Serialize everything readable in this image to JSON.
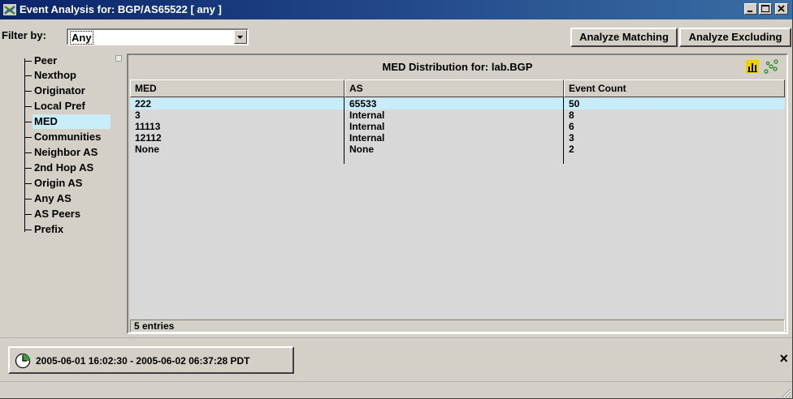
{
  "window": {
    "title": "Event Analysis for: BGP/AS65522 [  any ]"
  },
  "filter": {
    "label": "Filter by:",
    "selected": "Any",
    "analyze_matching": "Analyze Matching",
    "analyze_excluding": "Analyze Excluding"
  },
  "tree": {
    "items": [
      {
        "label": "Peer"
      },
      {
        "label": "Nexthop"
      },
      {
        "label": "Originator"
      },
      {
        "label": "Local Pref"
      },
      {
        "label": "MED"
      },
      {
        "label": "Communities"
      },
      {
        "label": "Neighbor AS"
      },
      {
        "label": "2nd Hop AS"
      },
      {
        "label": "Origin AS"
      },
      {
        "label": "Any AS"
      },
      {
        "label": "AS Peers"
      },
      {
        "label": "Prefix"
      }
    ],
    "selected": "MED"
  },
  "panel": {
    "title": "MED Distribution for: lab.BGP",
    "icons": [
      "bar-chart-icon",
      "scatter-plot-icon"
    ]
  },
  "table": {
    "columns": [
      "MED",
      "AS",
      "Event Count"
    ],
    "rows": [
      [
        "222",
        "65533",
        "50"
      ],
      [
        "3",
        "Internal",
        "8"
      ],
      [
        "11113",
        "Internal",
        "6"
      ],
      [
        "12112",
        "Internal",
        "3"
      ],
      [
        "None",
        "None",
        "2"
      ]
    ],
    "selected_row": 0,
    "status": "5 entries"
  },
  "timerange": {
    "text": "2005-06-01 16:02:30 - 2005-06-02 06:37:28 PDT",
    "close_symbol": "×"
  },
  "colors": {
    "titlebar": "#0a246a",
    "selection": "#c9ecf9",
    "face": "#d4d0c8"
  }
}
